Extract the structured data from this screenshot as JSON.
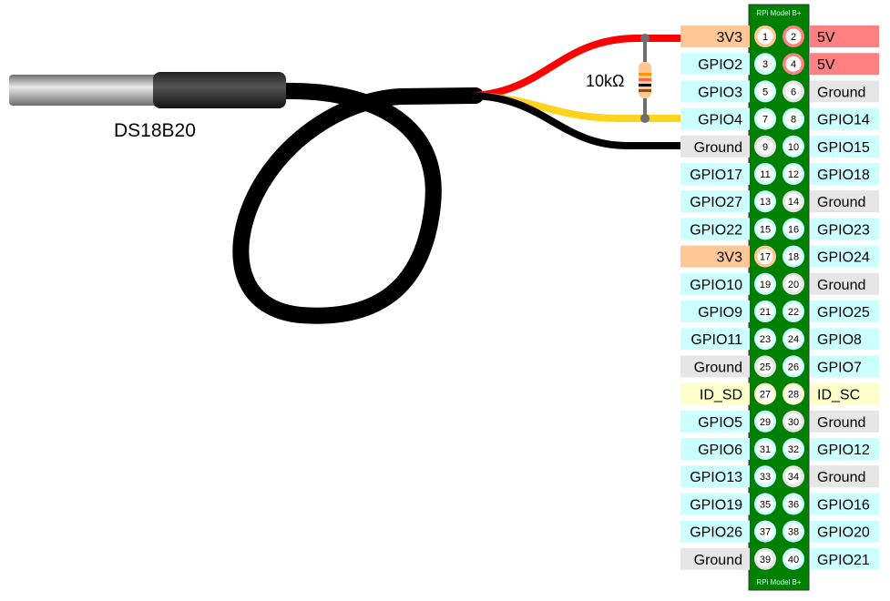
{
  "sensor": {
    "label": "DS18B20"
  },
  "resistor": {
    "label": "10kΩ"
  },
  "header": {
    "title_top": "RPi Model B+",
    "title_bottom": "RPi Model B+",
    "board_color": "#008000"
  },
  "pin_colors": {
    "3v3": "#ffc896",
    "5v": "#ff8080",
    "ground": "#e6e6e6",
    "gpio": "#ccffff",
    "id": "#ffffcc"
  },
  "wire_colors": {
    "vcc": "#ff0000",
    "data": "#ffd21e",
    "ground": "#000000"
  },
  "rows": [
    {
      "left": {
        "num": "1",
        "label": "3V3",
        "type": "3v3"
      },
      "right": {
        "num": "2",
        "label": "5V",
        "type": "5v"
      }
    },
    {
      "left": {
        "num": "3",
        "label": "GPIO2",
        "type": "gpio"
      },
      "right": {
        "num": "4",
        "label": "5V",
        "type": "5v"
      }
    },
    {
      "left": {
        "num": "5",
        "label": "GPIO3",
        "type": "gpio"
      },
      "right": {
        "num": "6",
        "label": "Ground",
        "type": "ground"
      }
    },
    {
      "left": {
        "num": "7",
        "label": "GPIO4",
        "type": "gpio"
      },
      "right": {
        "num": "8",
        "label": "GPIO14",
        "type": "gpio"
      }
    },
    {
      "left": {
        "num": "9",
        "label": "Ground",
        "type": "ground"
      },
      "right": {
        "num": "10",
        "label": "GPIO15",
        "type": "gpio"
      }
    },
    {
      "left": {
        "num": "11",
        "label": "GPIO17",
        "type": "gpio"
      },
      "right": {
        "num": "12",
        "label": "GPIO18",
        "type": "gpio"
      }
    },
    {
      "left": {
        "num": "13",
        "label": "GPIO27",
        "type": "gpio"
      },
      "right": {
        "num": "14",
        "label": "Ground",
        "type": "ground"
      }
    },
    {
      "left": {
        "num": "15",
        "label": "GPIO22",
        "type": "gpio"
      },
      "right": {
        "num": "16",
        "label": "GPIO23",
        "type": "gpio"
      }
    },
    {
      "left": {
        "num": "17",
        "label": "3V3",
        "type": "3v3"
      },
      "right": {
        "num": "18",
        "label": "GPIO24",
        "type": "gpio"
      }
    },
    {
      "left": {
        "num": "19",
        "label": "GPIO10",
        "type": "gpio"
      },
      "right": {
        "num": "20",
        "label": "Ground",
        "type": "ground"
      }
    },
    {
      "left": {
        "num": "21",
        "label": "GPIO9",
        "type": "gpio"
      },
      "right": {
        "num": "22",
        "label": "GPIO25",
        "type": "gpio"
      }
    },
    {
      "left": {
        "num": "23",
        "label": "GPIO11",
        "type": "gpio"
      },
      "right": {
        "num": "24",
        "label": "GPIO8",
        "type": "gpio"
      }
    },
    {
      "left": {
        "num": "25",
        "label": "Ground",
        "type": "ground"
      },
      "right": {
        "num": "26",
        "label": "GPIO7",
        "type": "gpio"
      }
    },
    {
      "left": {
        "num": "27",
        "label": "ID_SD",
        "type": "id"
      },
      "right": {
        "num": "28",
        "label": "ID_SC",
        "type": "id"
      }
    },
    {
      "left": {
        "num": "29",
        "label": "GPIO5",
        "type": "gpio"
      },
      "right": {
        "num": "30",
        "label": "Ground",
        "type": "ground"
      }
    },
    {
      "left": {
        "num": "31",
        "label": "GPIO6",
        "type": "gpio"
      },
      "right": {
        "num": "32",
        "label": "GPIO12",
        "type": "gpio"
      }
    },
    {
      "left": {
        "num": "33",
        "label": "GPIO13",
        "type": "gpio"
      },
      "right": {
        "num": "34",
        "label": "Ground",
        "type": "ground"
      }
    },
    {
      "left": {
        "num": "35",
        "label": "GPIO19",
        "type": "gpio"
      },
      "right": {
        "num": "36",
        "label": "GPIO16",
        "type": "gpio"
      }
    },
    {
      "left": {
        "num": "37",
        "label": "GPIO26",
        "type": "gpio"
      },
      "right": {
        "num": "38",
        "label": "GPIO20",
        "type": "gpio"
      }
    },
    {
      "left": {
        "num": "39",
        "label": "Ground",
        "type": "ground"
      },
      "right": {
        "num": "40",
        "label": "GPIO21",
        "type": "gpio"
      }
    }
  ]
}
